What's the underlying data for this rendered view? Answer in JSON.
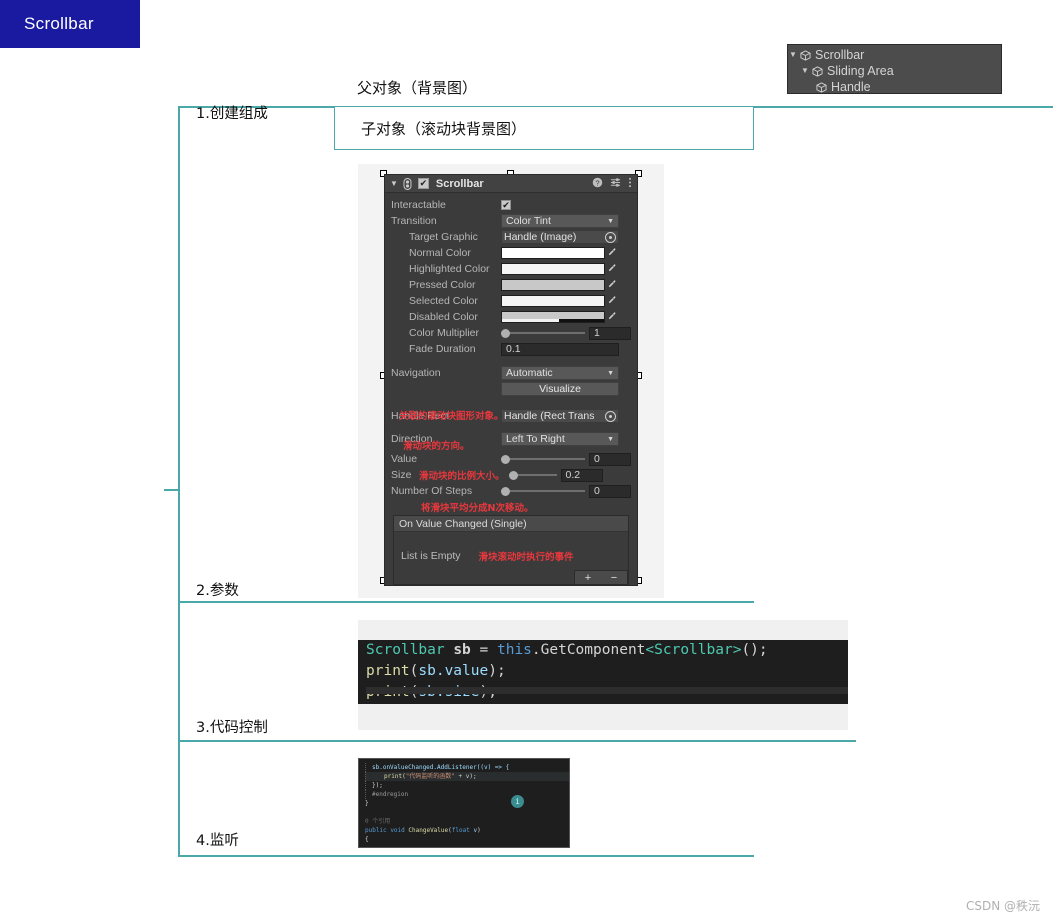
{
  "root_node": {
    "label": "Scrollbar"
  },
  "steps": [
    {
      "id": "step1",
      "label": "1.创建组成"
    },
    {
      "id": "step2",
      "label": "2.参数"
    },
    {
      "id": "step3",
      "label": "3.代码控制"
    },
    {
      "id": "step4",
      "label": "4.监听"
    }
  ],
  "callouts": {
    "parent_object": "父对象（背景图）",
    "child_object": "子对象（滚动块背景图）"
  },
  "hierarchy": {
    "items": [
      {
        "label": "Scrollbar",
        "indent": 0,
        "expanded": true
      },
      {
        "label": "Sliding Area",
        "indent": 1,
        "expanded": true
      },
      {
        "label": "Handle",
        "indent": 2,
        "expanded": false
      }
    ]
  },
  "inspector": {
    "title": "Scrollbar",
    "enabled": true,
    "rows": {
      "interactable_label": "Interactable",
      "transition_label": "Transition",
      "transition_value": "Color Tint",
      "target_graphic_label": "Target Graphic",
      "target_graphic_value": "Handle (Image)",
      "normal_color_label": "Normal Color",
      "highlighted_color_label": "Highlighted Color",
      "pressed_color_label": "Pressed Color",
      "selected_color_label": "Selected Color",
      "disabled_color_label": "Disabled Color",
      "color_multiplier_label": "Color Multiplier",
      "color_multiplier_value": "1",
      "fade_duration_label": "Fade Duration",
      "fade_duration_value": "0.1",
      "navigation_label": "Navigation",
      "navigation_value": "Automatic",
      "visualize_label": "Visualize",
      "handle_rect_label": "Handle Rect",
      "handle_rect_value": "Handle (Rect Trans",
      "direction_label": "Direction",
      "direction_value": "Left To Right",
      "value_label": "Value",
      "value_value": "0",
      "size_label": "Size",
      "size_value": "0.2",
      "steps_label": "Number Of Steps",
      "steps_value": "0",
      "event_title": "On Value Changed (Single)",
      "event_empty": "List is Empty",
      "event_add": "+",
      "event_remove": "−"
    },
    "colors": {
      "normal": "#ffffff",
      "highlighted": "#f5f5f5",
      "pressed": "#c8c8c8",
      "selected": "#f5f5f5",
      "disabled": "#c8c8c8"
    },
    "annotations": {
      "handle_rect": "关联的滚动块图形对象。",
      "direction": "滑动块的方向。",
      "size": "滑动块的比例大小。",
      "steps": "将滑块平均分成N次移动。",
      "event": "滑块滚动时执行的事件"
    }
  },
  "code_control": {
    "line1": {
      "type": "Scrollbar",
      "var": "sb",
      "eq": "=",
      "this": "this",
      "dot": ".",
      "call": "GetComponent",
      "generic": "<Scrollbar>",
      "tail": "();"
    },
    "line2": {
      "fn": "print",
      "open": "(",
      "arg": "sb.value",
      "close": ");"
    },
    "line3": {
      "fn": "print",
      "open": "(",
      "arg": "sb.size",
      "close": ");"
    }
  },
  "code_listen": {
    "line1": "sb.onValueChanged.AddListener((v) => {",
    "line2_fn": "print",
    "line2_str": "\"代码监听的函数\"",
    "line2_tail": " + v);",
    "line3": "});",
    "line4": "#endregion",
    "line5": "}",
    "line6": "0 个引用",
    "line7_kw1": "public",
    "line7_kw2": "void",
    "line7_fn": "ChangeValue",
    "line7_arg_kw": "float",
    "line7_arg": "v",
    "line8": "{"
  },
  "watermark": "CSDN @秩沅",
  "theme": {
    "teal": "#4aa8a8",
    "node_blue": "#1a1aa0",
    "annotation_red": "#e8373d"
  }
}
